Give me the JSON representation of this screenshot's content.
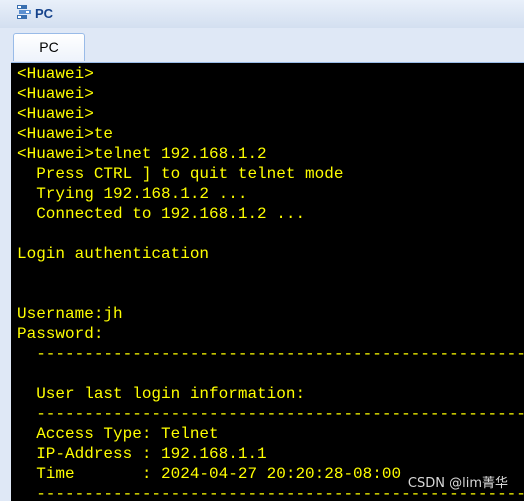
{
  "window": {
    "title": "PC"
  },
  "tabs": [
    {
      "label": "PC"
    }
  ],
  "terminal": {
    "lines": [
      "<Huawei>",
      "<Huawei>",
      "<Huawei>",
      "<Huawei>te",
      "<Huawei>telnet 192.168.1.2",
      "  Press CTRL ] to quit telnet mode",
      "  Trying 192.168.1.2 ...",
      "  Connected to 192.168.1.2 ...",
      "",
      "Login authentication",
      "",
      "",
      "Username:jh",
      "Password:",
      "  -----------------------------------------------------------",
      "",
      "  User last login information:",
      "  -----------------------------------------------------------",
      "  Access Type: Telnet",
      "  IP-Address : 192.168.1.1",
      "  Time       : 2024-04-27 20:20:28-08:00",
      "  -----------------------------------------------------------"
    ],
    "text_color": "#ffff00",
    "background_color": "#000000"
  },
  "watermark": {
    "text": "CSDN @lim菁华"
  }
}
